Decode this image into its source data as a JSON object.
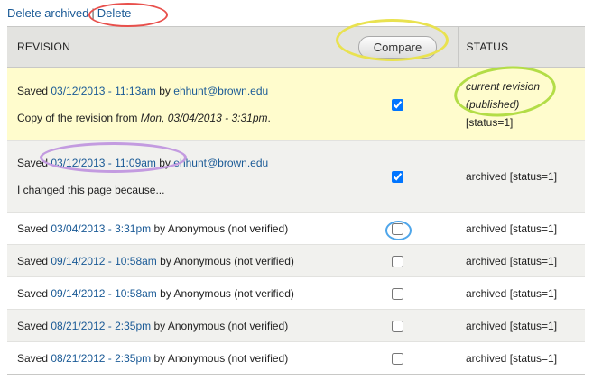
{
  "actions": {
    "delete_archived": "Delete archived",
    "separator": "|",
    "delete": "Delete"
  },
  "table": {
    "headers": {
      "revision": "REVISION",
      "status": "STATUS"
    },
    "compare_label": "Compare"
  },
  "revisions": [
    {
      "saved_prefix": "Saved",
      "date": "03/12/2013 - 11:13am",
      "by": "by",
      "author": "ehhunt@brown.edu",
      "author_is_link": true,
      "log_prefix": "Copy of the revision from",
      "log_em": "Mon, 03/04/2013 - 3:31pm",
      "log_suffix": ".",
      "checked": true,
      "status_em_1": "current revision",
      "status_em_2": "(published)",
      "status": "[status=1]"
    },
    {
      "saved_prefix": "Saved",
      "date": "03/12/2013 - 11:09am",
      "by": "by",
      "author": "ehhunt@brown.edu",
      "author_is_link": true,
      "log": "I changed this page because...",
      "checked": true,
      "status": "archived [status=1]"
    },
    {
      "saved_prefix": "Saved",
      "date": "03/04/2013 - 3:31pm",
      "by": "by",
      "author": "Anonymous (not verified)",
      "checked": false,
      "status": "archived [status=1]"
    },
    {
      "saved_prefix": "Saved",
      "date": "09/14/2012 - 10:58am",
      "by": "by",
      "author": "Anonymous (not verified)",
      "checked": false,
      "status": "archived [status=1]"
    },
    {
      "saved_prefix": "Saved",
      "date": "09/14/2012 - 10:58am",
      "by": "by",
      "author": "Anonymous (not verified)",
      "checked": false,
      "status": "archived [status=1]"
    },
    {
      "saved_prefix": "Saved",
      "date": "08/21/2012 - 2:35pm",
      "by": "by",
      "author": "Anonymous (not verified)",
      "checked": false,
      "status": "archived [status=1]"
    },
    {
      "saved_prefix": "Saved",
      "date": "08/21/2012 - 2:35pm",
      "by": "by",
      "author": "Anonymous (not verified)",
      "checked": false,
      "status": "archived [status=1]"
    }
  ],
  "colors": {
    "link": "#1a5a96",
    "current_row_bg": "#fffccd",
    "alt_row_bg": "#f1f1ee",
    "header_bg": "#e3e3e0",
    "annotation_red": "#e8504c",
    "annotation_yellow": "#e9e250",
    "annotation_green": "#b3dd47",
    "annotation_purple": "#c39be0",
    "annotation_blue": "#4fa6ea"
  }
}
